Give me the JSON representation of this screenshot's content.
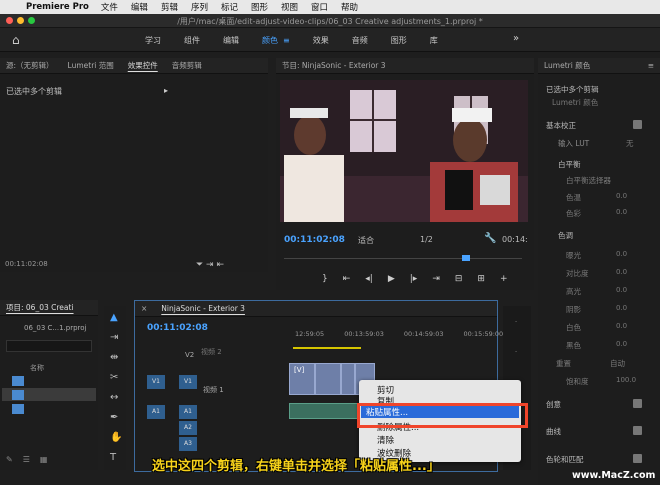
{
  "menubar": {
    "app": "Premiere Pro",
    "items": [
      "文件",
      "编辑",
      "剪辑",
      "序列",
      "标记",
      "图形",
      "视图",
      "窗口",
      "帮助"
    ]
  },
  "window": {
    "title": "/用户/mac/桌面/edit-adjust-video-clips/06_03 Creative adjustments_1.prproj *"
  },
  "workspaces": {
    "tabs": [
      "学习",
      "组件",
      "编辑",
      "颜色",
      "效果",
      "音频",
      "图形",
      "库"
    ],
    "active": "颜色"
  },
  "source_panel": {
    "tabs": [
      "源:（无剪辑）",
      "Lumetri 范围",
      "效果控件",
      "音频剪辑"
    ],
    "content": "已选中多个剪辑",
    "timecode": "00:11:02:08"
  },
  "program": {
    "title": "节目: NinjaSonic - Exterior 3",
    "timecode": "00:11:02:08",
    "fit": "适合",
    "resolution": "1/2",
    "duration": "00:14:"
  },
  "lumetri": {
    "title": "Lumetri 颜色",
    "selection": "已选中多个剪辑",
    "fx": "Lumetri 颜色",
    "sections": {
      "basic": "基本校正",
      "lut_label": "输入 LUT",
      "lut_value": "无",
      "wb": "白平衡",
      "wb_picker": "白平衡选择器",
      "temp": "色温",
      "tint": "色彩",
      "tone": "色调",
      "exposure": "曝光",
      "contrast": "对比度",
      "highlights": "高光",
      "shadows": "阴影",
      "whites": "白色",
      "blacks": "黑色",
      "reset": "重置",
      "auto": "自动",
      "saturation": "饱和度",
      "creative": "创意",
      "curves": "曲线",
      "color_wheels": "色轮和匹配"
    },
    "zero": "0.0",
    "hundred": "100.0"
  },
  "project": {
    "title": "项目: 06_03 Creati",
    "file": "06_03 C...1.prproj",
    "name_col": "名称"
  },
  "timeline": {
    "title": "NinjaSonic - Exterior 3",
    "timecode": "00:11:02:08",
    "ruler": [
      "12:59:05",
      "00:13:59:03",
      "00:14:59:03",
      "00:15:59:00"
    ],
    "tracks": {
      "v2": "V2",
      "v1": "V1",
      "video1": "视频 1",
      "a1": "A1",
      "a2": "A2",
      "a3": "A3",
      "video2": "视频 2"
    },
    "clip_label": "[V]"
  },
  "context_menu": {
    "items": [
      "剪切",
      "复制",
      "粘贴属性...",
      "删除属性...",
      "清除",
      "波纹删除"
    ],
    "highlighted": "粘贴属性..."
  },
  "caption": "选中这四个剪辑，右键单击并选择「粘贴属性...」",
  "watermark": "www.MacZ.com"
}
